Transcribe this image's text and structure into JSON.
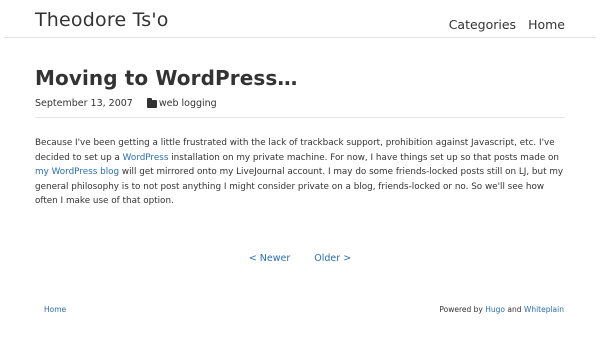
{
  "header": {
    "site_title": "Theodore Ts'o",
    "nav": [
      {
        "label": "Categories"
      },
      {
        "label": "Home"
      }
    ]
  },
  "post": {
    "title": "Moving to WordPress…",
    "date": "September 13, 2007",
    "category": "web logging",
    "category_icon": "folder-icon",
    "body": {
      "t1": "Because I've been getting a little frustrated with the lack of trackback support, prohibition against Javascript, etc. I've decided to set up a ",
      "link1": "WordPress",
      "t2": " installation on my private machine. For now, I have things set up so that posts made on ",
      "link2": "my WordPress blog",
      "t3": " will get mirrored onto my LiveJournal account. I may do some friends-locked posts still on LJ, but my general philosophy is to not post anything I might consider private on a blog, friends-locked or no. So we'll see how often I make use of that option."
    }
  },
  "pager": {
    "newer": "< Newer",
    "older": "Older >"
  },
  "footer": {
    "home": "Home",
    "powered_prefix": "Powered by ",
    "hugo": "Hugo",
    "and": " and ",
    "theme": "Whiteplain"
  },
  "colors": {
    "link": "#2a6fb5",
    "text": "#333333",
    "rule": "#e3e3e3"
  }
}
